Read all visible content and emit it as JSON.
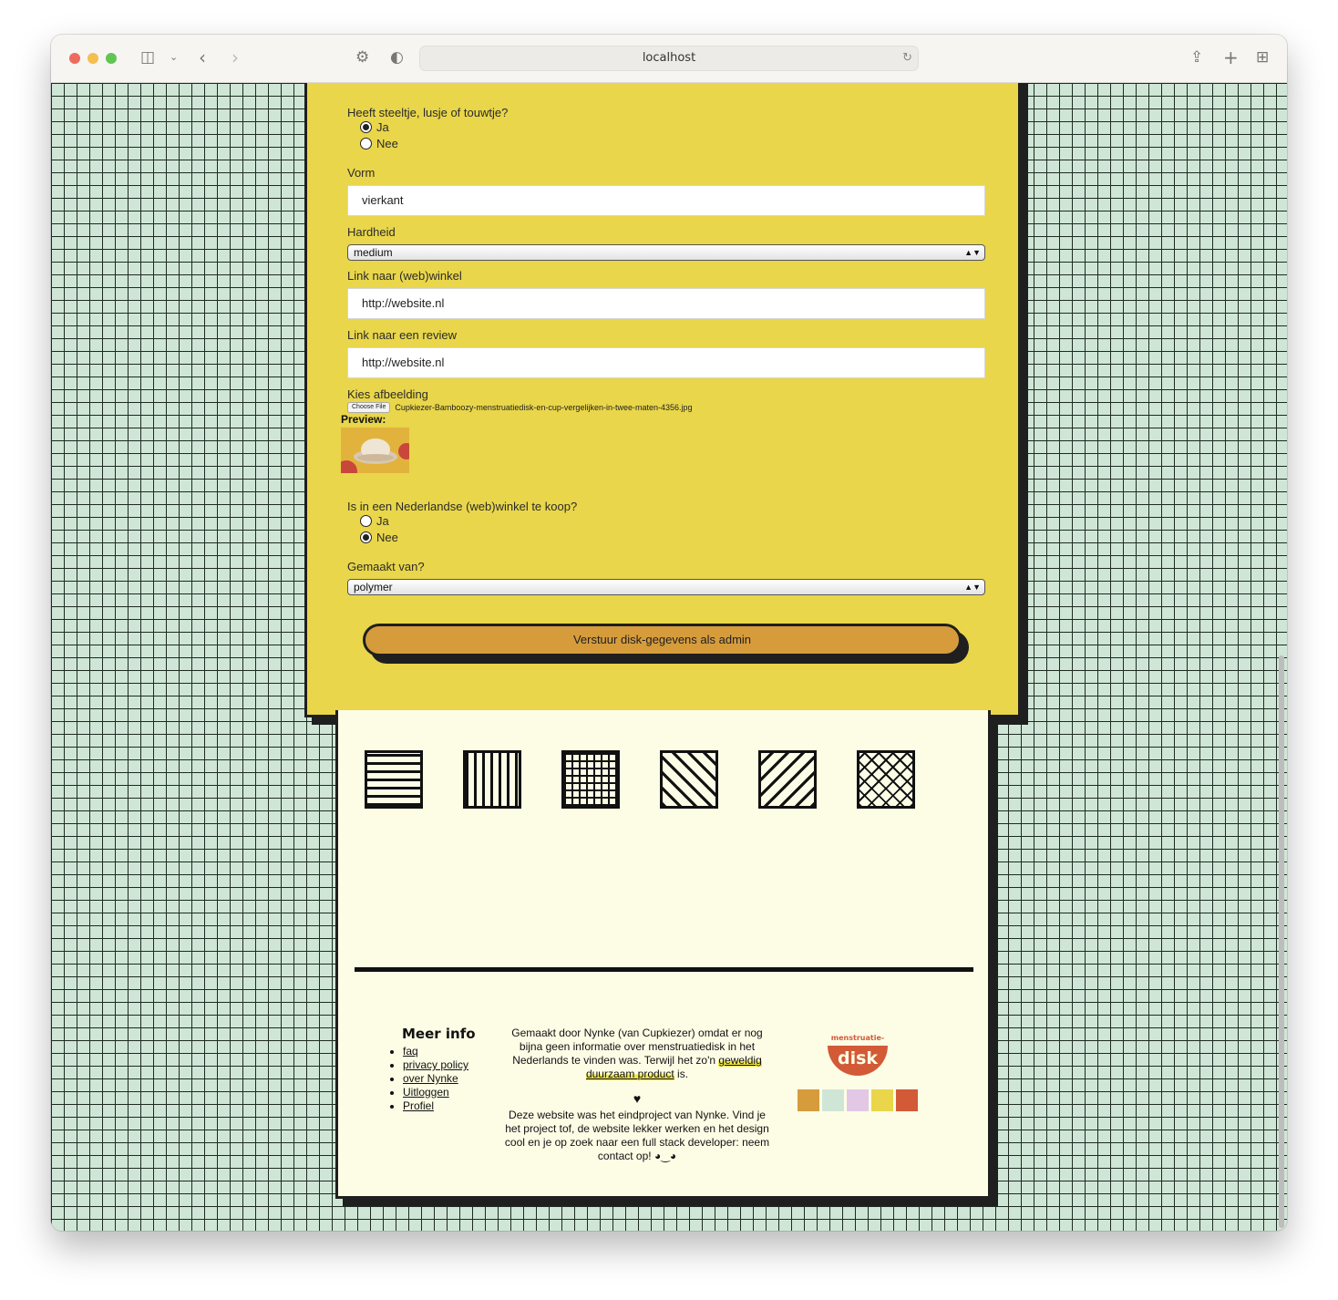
{
  "browser": {
    "url": "localhost",
    "traffic_lights": [
      "#ec6a5e",
      "#f4bf4f",
      "#61c554"
    ]
  },
  "form": {
    "steeltje": {
      "label": "Heeft steeltje, lusje of touwtje?",
      "options": [
        "Ja",
        "Nee"
      ],
      "selected": "Ja"
    },
    "vorm": {
      "label": "Vorm",
      "value": "vierkant"
    },
    "hardheid": {
      "label": "Hardheid",
      "value": "medium"
    },
    "webwinkel": {
      "label": "Link naar (web)winkel",
      "value": "http://website.nl"
    },
    "review": {
      "label": "Link naar een review",
      "value": "http://website.nl"
    },
    "afbeelding": {
      "label": "Kies afbeelding",
      "button": "Choose File",
      "filename": "Cupkiezer-Bamboozy-menstruatiedisk-en-cup-vergelijken-in-twee-maten-4356.jpg",
      "preview_label": "Preview:"
    },
    "te_koop": {
      "label": "Is in een Nederlandse (web)winkel te koop?",
      "options": [
        "Ja",
        "Nee"
      ],
      "selected": "Nee"
    },
    "gemaakt_van": {
      "label": "Gemaakt van?",
      "value": "polymer"
    },
    "submit_label": "Verstuur disk-gegevens als admin"
  },
  "footer": {
    "patterns": [
      "horizontal-lines-pattern",
      "vertical-lines-pattern",
      "grid-pattern",
      "diagonal-down-pattern",
      "diagonal-up-pattern",
      "crosshatch-pattern"
    ],
    "meer_info_title": "Meer info",
    "links": [
      "faq",
      "privacy policy",
      "over Nynke",
      "Uitloggen",
      "Profiel"
    ],
    "about_text_1": "Gemaakt door Nynke (van Cupkiezer) omdat er nog bijna geen informatie over menstruatiedisk in het Nederlands te vinden was. Terwijl het zo'n",
    "about_highlight": "geweldig duurzaam product",
    "about_text_2": "is.",
    "heart": "♥",
    "about_text_3": "Deze website was het eindproject van Nynke. Vind je het project tof, de website lekker werken en het design cool en je op zoek naar een full stack developer: neem contact op! ◕‿◕",
    "logo_text_top": "menstruatie-",
    "logo_text_main": "disk",
    "swatches": [
      "#d69c3c",
      "#cfe6d6",
      "#e2c8e4",
      "#e9d64a",
      "#d25a36"
    ]
  }
}
